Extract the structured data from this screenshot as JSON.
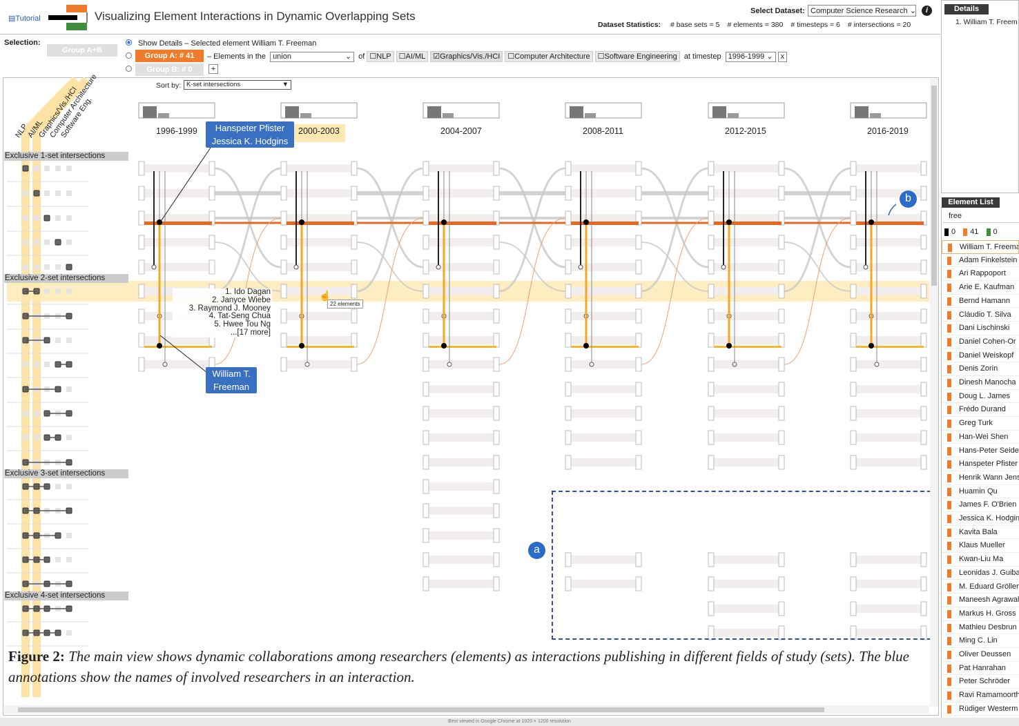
{
  "header": {
    "tutorial": "Tutorial",
    "title": "Visualizing Element Interactions in Dynamic Overlapping Sets",
    "dataset_label": "Select Dataset:",
    "dataset_value": "Computer Science Research",
    "stats_label": "Dataset Statistics:",
    "stats": [
      "# base sets = 5",
      "# elements = 380",
      "# timesteps = 6",
      "# intersections = 20"
    ],
    "info": "i"
  },
  "selection": {
    "label": "Selection:",
    "group_ab": "Group A+B",
    "show_details": "Show Details – Selected element William T. Freeman",
    "group_a": "Group A: # 41",
    "elements_in_the": "– Elements in the",
    "union": "union",
    "of": "of",
    "sets": [
      {
        "label": "NLP",
        "checked": false
      },
      {
        "label": "AI/ML",
        "checked": false
      },
      {
        "label": "Graphics/Vis./HCI",
        "checked": true
      },
      {
        "label": "Computer Architecture",
        "checked": false
      },
      {
        "label": "Software Engineering",
        "checked": false
      }
    ],
    "at_timestep": "at timestep",
    "timestep": "1996-1999",
    "clear": "x",
    "group_b": "Group B: # 0",
    "plus": "+"
  },
  "main": {
    "sort_label": "Sort by:",
    "sort_value": "K-set intersections",
    "set_names": [
      "NLP",
      "AI/ML",
      "Graphics/Vis./HCI",
      "Computer Architecture",
      "Software Eng."
    ],
    "sections": [
      "Exclusive 1-set intersections",
      "Exclusive 2-set intersections",
      "Exclusive 3-set intersections",
      "Exclusive 4-set intersections"
    ],
    "timesteps": [
      "1996-1999",
      "2000-2003",
      "2004-2007",
      "2008-2011",
      "2012-2015",
      "2016-2019"
    ],
    "annotation_top": [
      "Hanspeter Pfister",
      "Jessica K. Hodgins"
    ],
    "annotation_bottom": [
      "William T.",
      "Freeman"
    ],
    "tooltip": [
      "1. Ido Dagan",
      "2. Janyce Wiebe",
      "3. Raymond J. Mooney",
      "4. Tat-Seng Chua",
      "5. Hwee Tou Ng",
      "...[17 more]"
    ],
    "hover": "22 elements",
    "badge_a": "a",
    "badge_b": "b",
    "caption_label": "Figure 2:",
    "caption_text": "The main view shows dynamic collaborations among researchers (elements) as interactions publishing in different fields of study (sets). The blue annotations show the names of involved researchers in an interaction."
  },
  "details": {
    "tab": "Details",
    "item": "1. William T. Freem"
  },
  "element_list": {
    "tab": "Element List",
    "filter": "free",
    "counts": [
      "0",
      "41",
      "0"
    ],
    "items": [
      "William T. Freema",
      "Adam Finkelstein",
      "Ari Rappoport",
      "Arie E. Kaufman",
      "Bernd Hamann",
      "Cláudio T. Silva",
      "Dani Lischinski",
      "Daniel Cohen-Or",
      "Daniel Weiskopf",
      "Denis Zorin",
      "Dinesh Manocha",
      "Doug L. James",
      "Frédo Durand",
      "Greg Turk",
      "Han-Wei Shen",
      "Hans-Peter Seide",
      "Hanspeter Pfister",
      "Henrik Wann Jens",
      "Huamin Qu",
      "James F. O'Brien",
      "Jessica K. Hodgin",
      "Kavita Bala",
      "Klaus Mueller",
      "Kwan-Liu Ma",
      "Leonidas J. Guiba",
      "M. Eduard Gröller",
      "Maneesh Agrawal",
      "Markus H. Gross",
      "Mathieu Desbrun",
      "Ming C. Lin",
      "Oliver Deussen",
      "Pat Hanrahan",
      "Peter Schröder",
      "Ravi Ramamoorth",
      "Rüdiger Westerm"
    ]
  },
  "footer": "Best viewed in Google Chrome at 1920 × 1200 resolution"
}
